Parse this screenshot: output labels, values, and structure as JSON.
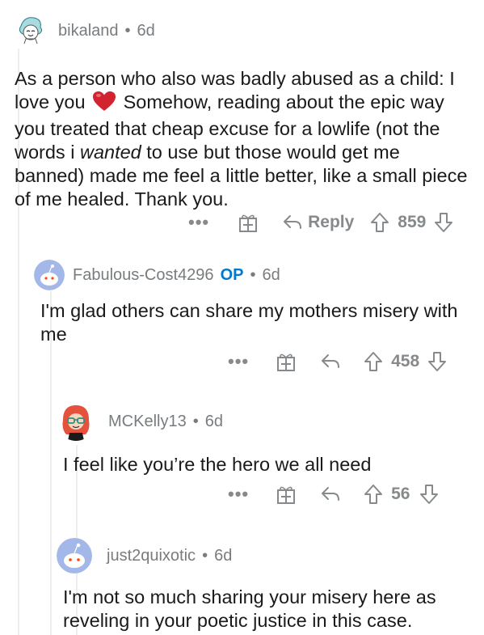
{
  "comments": [
    {
      "username": "bikaland",
      "age": "6d",
      "body_part1": "As a person who also was badly abused as a child: I love you",
      "body_part2": "Somehow, reading about the epic way you treated that cheap excuse for a lowlife (not the words i",
      "body_em": "wanted",
      "body_part3": "to use but those would get me banned) made me feel a little better, like a small piece of me healed. Thank you.",
      "more": "•••",
      "reply_label": "Reply",
      "votes": "859"
    },
    {
      "username": "Fabulous-Cost4296",
      "op_badge": "OP",
      "age": "6d",
      "body": "I'm glad others can share my mothers misery with me",
      "more": "•••",
      "votes": "458"
    },
    {
      "username": "MCKelly13",
      "age": "6d",
      "body": "I feel like you’re the hero we all need",
      "more": "•••",
      "votes": "56"
    },
    {
      "username": "just2quixotic",
      "age": "6d",
      "body": "I'm not so much sharing your misery here as reveling in your poetic justice in this case."
    }
  ],
  "separator": "•",
  "icons": [
    "heart-emoji",
    "award-icon",
    "reply-arrow-icon",
    "upvote-icon",
    "downvote-icon"
  ],
  "colors": {
    "op_blue": "#0079d3",
    "meta_gray": "#787c7e",
    "heart_red": "#d1242f"
  }
}
